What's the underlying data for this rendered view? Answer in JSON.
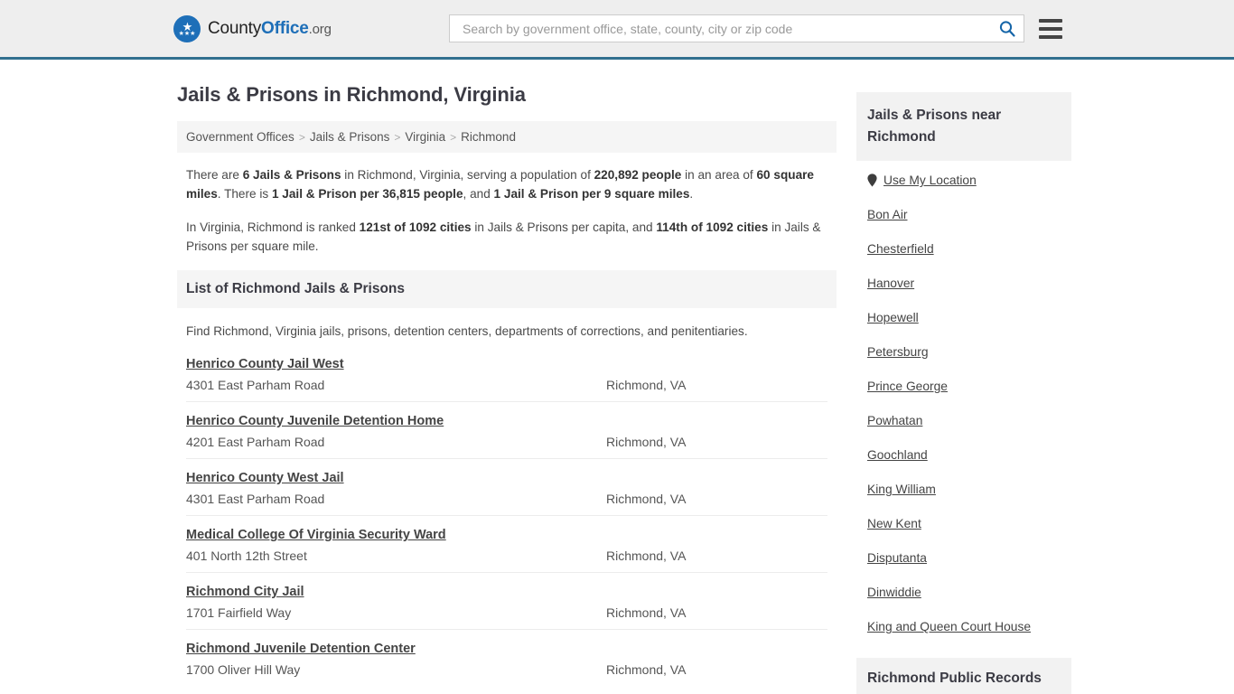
{
  "header": {
    "brand": {
      "part1": "County",
      "part2": "Office",
      "part3": ".org",
      "logo_icon": "eagle-shield-logo"
    },
    "search": {
      "placeholder": "Search by government office, state, county, city or zip code",
      "value": "",
      "icon": "search-icon"
    },
    "menu_icon": "hamburger-menu-icon",
    "accent_color": "#31708f",
    "brand_blue": "#1e6fb8"
  },
  "page": {
    "title": "Jails & Prisons in Richmond, Virginia"
  },
  "breadcrumb": {
    "items": [
      {
        "label": "Government Offices"
      },
      {
        "label": "Jails & Prisons"
      },
      {
        "label": "Virginia"
      },
      {
        "label": "Richmond"
      }
    ],
    "separator": ">"
  },
  "intro": {
    "p1": {
      "t1": "There are ",
      "b1": "6 Jails & Prisons",
      "t2": " in Richmond, Virginia, serving a population of ",
      "b2": "220,892 people",
      "t3": " in an area of ",
      "b3": "60 square miles",
      "t4": ". There is ",
      "b4": "1 Jail & Prison per 36,815 people",
      "t5": ", and ",
      "b5": "1 Jail & Prison per 9 square miles",
      "t6": "."
    },
    "p2": {
      "t1": "In Virginia, Richmond is ranked ",
      "b1": "121st of 1092 cities",
      "t2": " in Jails & Prisons per capita, and ",
      "b2": "114th of 1092 cities",
      "t3": " in Jails & Prisons per square mile."
    }
  },
  "list_section": {
    "heading": "List of Richmond Jails & Prisons",
    "subtext": "Find Richmond, Virginia jails, prisons, detention centers, departments of corrections, and penitentiaries.",
    "rows": [
      {
        "name": "Henrico County Jail West",
        "address": "4301 East Parham Road",
        "city": "Richmond, VA"
      },
      {
        "name": "Henrico County Juvenile Detention Home",
        "address": "4201 East Parham Road",
        "city": "Richmond, VA"
      },
      {
        "name": "Henrico County West Jail",
        "address": "4301 East Parham Road",
        "city": "Richmond, VA"
      },
      {
        "name": "Medical College Of Virginia Security Ward",
        "address": "401 North 12th Street",
        "city": "Richmond, VA"
      },
      {
        "name": "Richmond City Jail",
        "address": "1701 Fairfield Way",
        "city": "Richmond, VA"
      },
      {
        "name": "Richmond Juvenile Detention Center",
        "address": "1700 Oliver Hill Way",
        "city": "Richmond, VA"
      }
    ]
  },
  "sidebar": {
    "heading": "Jails & Prisons near Richmond",
    "use_my_location": {
      "label": "Use My Location",
      "icon": "map-pin-icon"
    },
    "nearby": [
      {
        "label": "Bon Air"
      },
      {
        "label": "Chesterfield"
      },
      {
        "label": "Hanover"
      },
      {
        "label": "Hopewell"
      },
      {
        "label": "Petersburg"
      },
      {
        "label": "Prince George"
      },
      {
        "label": "Powhatan"
      },
      {
        "label": "Goochland"
      },
      {
        "label": "King William"
      },
      {
        "label": "New Kent"
      },
      {
        "label": "Disputanta"
      },
      {
        "label": "Dinwiddie"
      },
      {
        "label": "King and Queen Court House"
      }
    ],
    "public_records_heading": "Richmond Public Records"
  }
}
